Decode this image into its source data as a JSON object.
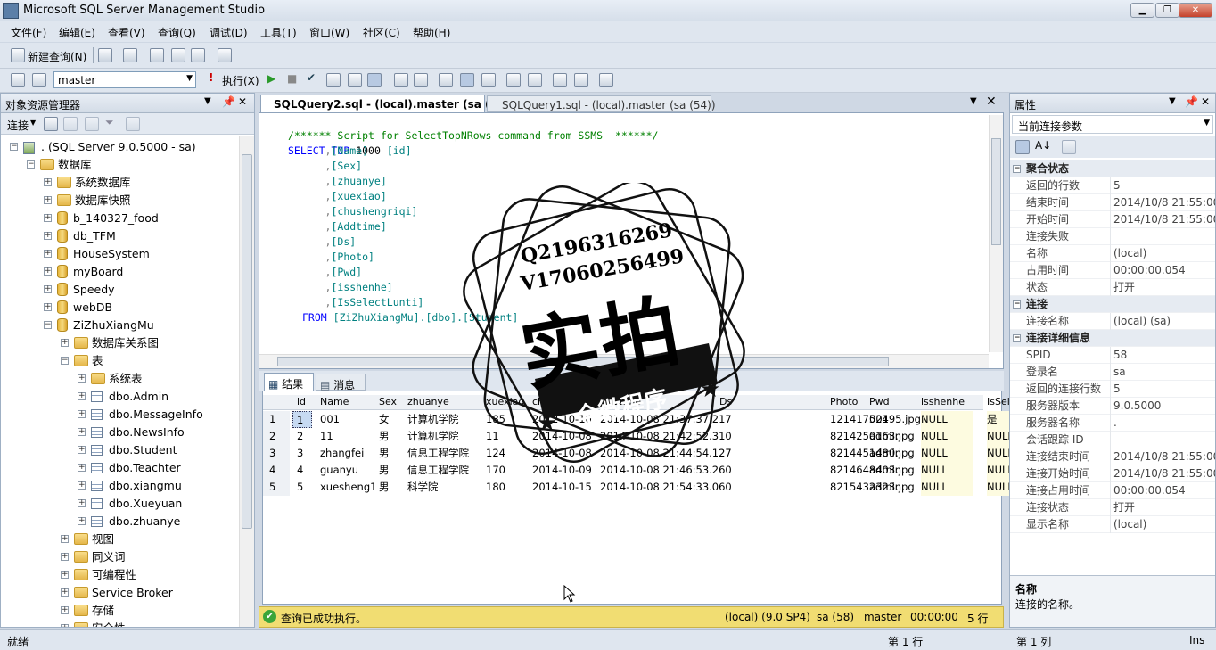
{
  "window": {
    "title": "Microsoft SQL Server Management Studio"
  },
  "menu": [
    "文件(F)",
    "编辑(E)",
    "查看(V)",
    "查询(Q)",
    "调试(D)",
    "工具(T)",
    "窗口(W)",
    "社区(C)",
    "帮助(H)"
  ],
  "toolbar1": {
    "new_query": "新建查询(N)"
  },
  "toolbar2": {
    "database": "master",
    "execute": "执行(X)"
  },
  "explorer": {
    "title": "对象资源管理器",
    "connect": "连接",
    "nodes": [
      {
        "label": ". (SQL Server 9.0.5000 - sa)",
        "level": 0,
        "icon": "server",
        "pm": "-"
      },
      {
        "label": "数据库",
        "level": 1,
        "icon": "folder",
        "pm": "-"
      },
      {
        "label": "系统数据库",
        "level": 2,
        "icon": "folder",
        "pm": "+"
      },
      {
        "label": "数据库快照",
        "level": 2,
        "icon": "folder",
        "pm": "+"
      },
      {
        "label": "b_140327_food",
        "level": 2,
        "icon": "db",
        "pm": "+"
      },
      {
        "label": "db_TFM",
        "level": 2,
        "icon": "db",
        "pm": "+"
      },
      {
        "label": "HouseSystem",
        "level": 2,
        "icon": "db",
        "pm": "+"
      },
      {
        "label": "myBoard",
        "level": 2,
        "icon": "db",
        "pm": "+"
      },
      {
        "label": "Speedy",
        "level": 2,
        "icon": "db",
        "pm": "+"
      },
      {
        "label": "webDB",
        "level": 2,
        "icon": "db",
        "pm": "+"
      },
      {
        "label": "ZiZhuXiangMu",
        "level": 2,
        "icon": "db",
        "pm": "-"
      },
      {
        "label": "数据库关系图",
        "level": 3,
        "icon": "folder",
        "pm": "+"
      },
      {
        "label": "表",
        "level": 3,
        "icon": "folder",
        "pm": "-"
      },
      {
        "label": "系统表",
        "level": 4,
        "icon": "folder",
        "pm": "+"
      },
      {
        "label": "dbo.Admin",
        "level": 4,
        "icon": "table",
        "pm": "+"
      },
      {
        "label": "dbo.MessageInfo",
        "level": 4,
        "icon": "table",
        "pm": "+"
      },
      {
        "label": "dbo.NewsInfo",
        "level": 4,
        "icon": "table",
        "pm": "+"
      },
      {
        "label": "dbo.Student",
        "level": 4,
        "icon": "table",
        "pm": "+"
      },
      {
        "label": "dbo.Teachter",
        "level": 4,
        "icon": "table",
        "pm": "+"
      },
      {
        "label": "dbo.xiangmu",
        "level": 4,
        "icon": "table",
        "pm": "+"
      },
      {
        "label": "dbo.Xueyuan",
        "level": 4,
        "icon": "table",
        "pm": "+"
      },
      {
        "label": "dbo.zhuanye",
        "level": 4,
        "icon": "table",
        "pm": "+"
      },
      {
        "label": "视图",
        "level": 3,
        "icon": "folder",
        "pm": "+"
      },
      {
        "label": "同义词",
        "level": 3,
        "icon": "folder",
        "pm": "+"
      },
      {
        "label": "可编程性",
        "level": 3,
        "icon": "folder",
        "pm": "+"
      },
      {
        "label": "Service Broker",
        "level": 3,
        "icon": "folder",
        "pm": "+"
      },
      {
        "label": "存储",
        "level": 3,
        "icon": "folder",
        "pm": "+"
      },
      {
        "label": "安全性",
        "level": 3,
        "icon": "folder",
        "pm": "+"
      }
    ]
  },
  "tabs": [
    {
      "label": "SQLQuery2.sql - (local).master (sa (58))",
      "active": true
    },
    {
      "label": "SQLQuery1.sql - (local).master (sa (54))",
      "active": false
    }
  ],
  "query": {
    "comment": "/****** Script for SelectTopNRows command from SSMS  ******/",
    "select_kw": "SELECT TOP",
    "top_n": "1000",
    "first_col": "[id]",
    "cols": [
      "[Name]",
      "[Sex]",
      "[zhuanye]",
      "[xuexiao]",
      "[chushengriqi]",
      "[Addtime]",
      "[Ds]",
      "[Photo]",
      "[Pwd]",
      "[isshenhe]",
      "[IsSelectLunti]"
    ],
    "from_kw": "FROM",
    "from_obj": "[ZiZhuXiangMu].[dbo].[Student]"
  },
  "results": {
    "tab_results": "结果",
    "tab_messages": "消息",
    "headers": [
      "id",
      "Name",
      "Sex",
      "zhuanye",
      "xuexiao",
      "chushengriqi",
      "Addtime",
      "Ds",
      "Photo",
      "Pwd",
      "isshenhe",
      "IsSelectLunti"
    ],
    "rows": [
      [
        "1",
        "001",
        "女",
        "计算机学院",
        "185",
        "2012-10-10",
        "2014-10-08 21:37:37.217",
        "",
        "12141752495.jpg",
        "001",
        "NULL",
        "是"
      ],
      [
        "2",
        "11",
        "男",
        "计算机学院",
        "11",
        "2014-10-08",
        "2014-10-08 21:42:52.310",
        "",
        "8214250163.jpg",
        "admin",
        "NULL",
        "NULL"
      ],
      [
        "3",
        "zhangfei",
        "男",
        "信息工程学院",
        "124",
        "2014-10-08",
        "2014-10-08 21:44:54.127",
        "",
        "8214451480.jpg",
        "admin",
        "NULL",
        "NULL"
      ],
      [
        "4",
        "guanyu",
        "男",
        "信息工程学院",
        "170",
        "2014-10-09",
        "2014-10-08 21:46:53.260",
        "",
        "8214648403.jpg",
        "admin",
        "NULL",
        "NULL"
      ],
      [
        "5",
        "xuesheng1",
        "男",
        "科学院",
        "180",
        "2014-10-15",
        "2014-10-08 21:54:33.060",
        "",
        "8215432323.jpg",
        "admin",
        "NULL",
        "NULL"
      ]
    ]
  },
  "query_status": {
    "message": "查询已成功执行。",
    "server": "(local) (9.0 SP4)",
    "user": "sa (58)",
    "db": "master",
    "time": "00:00:00",
    "rows": "5 行"
  },
  "properties": {
    "title": "属性",
    "dropdown": "当前连接参数",
    "rows": [
      {
        "cat": "聚合状态"
      },
      {
        "k": "返回的行数",
        "v": "5"
      },
      {
        "k": "结束时间",
        "v": "2014/10/8 21:55:00"
      },
      {
        "k": "开始时间",
        "v": "2014/10/8 21:55:00"
      },
      {
        "k": "连接失败",
        "v": ""
      },
      {
        "k": "名称",
        "v": "(local)"
      },
      {
        "k": "占用时间",
        "v": "00:00:00.054"
      },
      {
        "k": "状态",
        "v": "打开"
      },
      {
        "cat": "连接"
      },
      {
        "k": "连接名称",
        "v": "(local) (sa)"
      },
      {
        "cat": "连接详细信息"
      },
      {
        "k": "SPID",
        "v": "58"
      },
      {
        "k": "登录名",
        "v": "sa"
      },
      {
        "k": "返回的连接行数",
        "v": "5"
      },
      {
        "k": "服务器版本",
        "v": "9.0.5000"
      },
      {
        "k": "服务器名称",
        "v": "."
      },
      {
        "k": "会话跟踪 ID",
        "v": ""
      },
      {
        "k": "连接结束时间",
        "v": "2014/10/8 21:55:00"
      },
      {
        "k": "连接开始时间",
        "v": "2014/10/8 21:55:00"
      },
      {
        "k": "连接占用时间",
        "v": "00:00:00.054"
      },
      {
        "k": "连接状态",
        "v": "打开"
      },
      {
        "k": "显示名称",
        "v": "(local)"
      }
    ],
    "desc_title": "名称",
    "desc_text": "连接的名称。"
  },
  "statusbar": {
    "ready": "就绪",
    "line": "第 1 行",
    "col": "第 1 列",
    "mode": "Ins"
  },
  "watermark": {
    "line1": "Q2196316269",
    "line2": "V17060256499",
    "big": "实拍",
    "banner": "全微程序"
  }
}
